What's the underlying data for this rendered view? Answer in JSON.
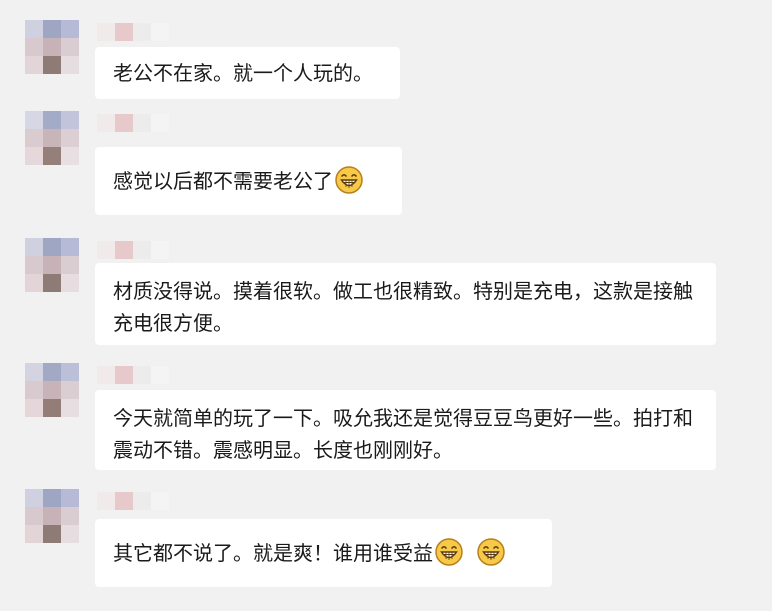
{
  "messages": [
    {
      "text": "老公不在家。就一个人玩的。",
      "emojis": []
    },
    {
      "text": "感觉以后都不需要老公了",
      "emojis": [
        "grin-emoji"
      ]
    },
    {
      "text": "材质没得说。摸着很软。做工也很精致。特别是充电，这款是接触充电很方便。",
      "emojis": []
    },
    {
      "text": "今天就简单的玩了一下。吸允我还是觉得豆豆鸟更好一些。拍打和震动不错。震感明显。长度也刚刚好。",
      "emojis": []
    },
    {
      "text": "其它都不说了。就是爽！谁用谁受益",
      "emojis": [
        "grin-emoji",
        "grin-emoji"
      ]
    }
  ],
  "colors": {
    "background": "#f1f1f1",
    "bubble": "#ffffff",
    "text": "#1a1a1a",
    "emoji_face": "#f7c948"
  }
}
